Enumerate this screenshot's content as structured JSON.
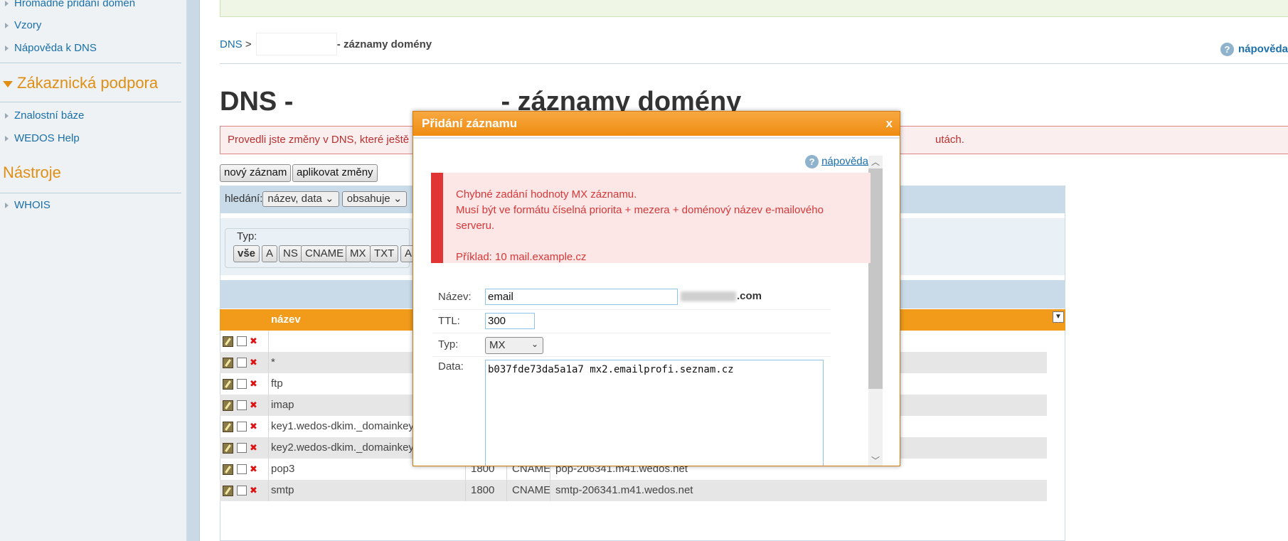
{
  "sidebar": {
    "links_top": [
      "Hromadné přidání domén",
      "Vzory",
      "Nápověda k DNS"
    ],
    "support_heading": "Zákaznická podpora",
    "support_links": [
      "Znalostní báze",
      "WEDOS Help"
    ],
    "tools_heading": "Nástroje",
    "tools_links": [
      "WHOIS"
    ]
  },
  "breadcrumb": {
    "root": "DNS",
    "sep": " > ",
    "suffix": "- záznamy domény"
  },
  "help_top": "nápověda",
  "page_title": {
    "prefix": "DNS -",
    "suffix": "- záznamy domény"
  },
  "alert": {
    "left": "Provedli jste změny v DNS, které ještě n",
    "right": "utách."
  },
  "toolbar": {
    "new_record": "nový záznam",
    "apply_changes": "aplikovat změny"
  },
  "search": {
    "label": "hledání:",
    "field_select": "název, data",
    "mode_select": "obsahuje"
  },
  "type_filter": {
    "label": "Typ:",
    "buttons": [
      "vše",
      "A",
      "NS",
      "CNAME",
      "MX",
      "TXT",
      "A"
    ]
  },
  "table": {
    "header_name": "název",
    "rows": [
      {
        "name": "",
        "ttl": "",
        "type": "",
        "data": ""
      },
      {
        "name": "*",
        "ttl": "",
        "type": "",
        "data": ""
      },
      {
        "name": "ftp",
        "ttl": "",
        "type": "",
        "data": ""
      },
      {
        "name": "imap",
        "ttl": "",
        "type": "",
        "data": ""
      },
      {
        "name": "key1.wedos-dkim._domainkey",
        "ttl": "",
        "type": "",
        "data": ""
      },
      {
        "name": "key2.wedos-dkim._domainkey",
        "ttl": "",
        "type": "",
        "data": ""
      },
      {
        "name": "pop3",
        "ttl": "1800",
        "type": "CNAME",
        "data": "pop-206341.m41.wedos.net"
      },
      {
        "name": "smtp",
        "ttl": "1800",
        "type": "CNAME",
        "data": "smtp-206341.m41.wedos.net"
      }
    ]
  },
  "modal": {
    "title": "Přidání záznamu",
    "close": "x",
    "help": "nápověda",
    "error_lines": [
      "Chybné zadání hodnoty MX záznamu.",
      "Musí být ve formátu číselná priorita + mezera + doménový název e-mailového serveru.",
      "",
      "Příklad: 10 mail.example.cz"
    ],
    "labels": {
      "name": "Název:",
      "ttl": "TTL:",
      "type": "Typ:",
      "data": "Data:"
    },
    "values": {
      "name": "email",
      "domain_suffix": ".com",
      "ttl": "300",
      "type": "MX",
      "data": "b037fde73da5a1a7 mx2.emailprofi.seznam.cz"
    }
  },
  "colors": {
    "accent": "#ef8c10",
    "link": "#1a6fa8",
    "error": "#e13535"
  }
}
